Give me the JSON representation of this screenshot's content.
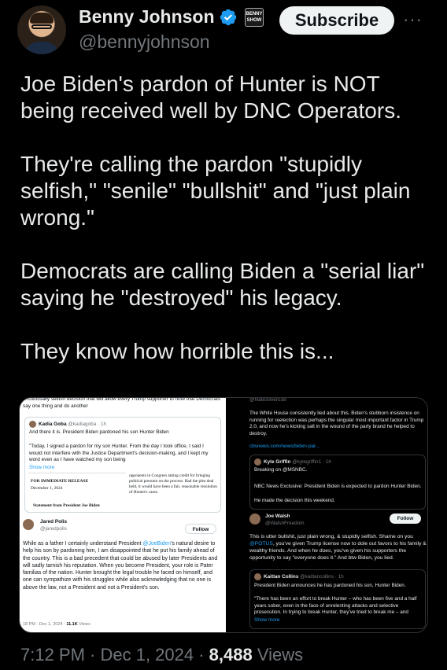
{
  "author": {
    "name": "Benny Johnson",
    "handle": "@bennyjohnson",
    "badge_text": "BENNY SHOW"
  },
  "actions": {
    "subscribe_label": "Subscribe",
    "more_label": "···"
  },
  "tweet": {
    "paragraphs": [
      "Joe Biden's pardon of Hunter is NOT being received well by DNC Operators.",
      "They're calling the pardon \"stupidly selfish,\" \"senile\" \"bullshit\" and \"just plain wrong.\"",
      "Democrats are calling Biden a \"serial liar\" saying he \"destroyed\" his legacy.",
      "They know how horrible this is..."
    ]
  },
  "media": {
    "left": {
      "top_text": "…colossally selfish decision that will allow every Trump supporter to note that Democrats say one thing and do another",
      "quote": {
        "name": "Kadia Goba",
        "meta": "@kadiagoba · 1h",
        "line1": "And there it is.  President Biden pardoned  his son Hunter Biden",
        "body": "\"Today, I signed a pardon for my son Hunter. From the day I took office, I said I would not interfere with the Justice Department's decision-making, and I kept my word even as I have watched my son being",
        "show_more": "Show more",
        "doc_header": "FOR IMMEDIATE RELEASE",
        "doc_date": "December 1, 2024",
        "doc_title": "Statement from President Joe Biden",
        "doc_side": "opponents in Congress taking credit for bringing political pressure on the process. Had the plea deal held, it would have been a fair, reasonable resolution of Hunter's cases."
      },
      "post": {
        "name": "Jared Polis",
        "handle": "@jaredpolis",
        "follow": "Follow",
        "body_pre": "While as a father I certainly understand President ",
        "mention": "@JoeBiden",
        "body_post": "'s natural desire to help his son by pardoning him, I am disappointed that he put his family ahead of the country. This is a bad precedent that could be abused by later Presidents and will sadly tarnish his reputation. When you become President, your role is Pater familias of the nation. Hunter brought the legal trouble he faced on himself, and one can sympathize with his struggles while also acknowledging that no one is above the law, not a President and not a President's son.",
        "time": "18 PM · Dec 1, 2024 · ",
        "views": "11.1K",
        "views_label": " Views"
      }
    },
    "right": {
      "top_handle": "@NateSilver538",
      "top_body": "The White House consistently lied about this. Biden's stubborn insistence on running for reelection was perhaps the singular most important factor in Trump 2.0, and now he's kicking salt in the wound of the party brand he helped to destroy.",
      "top_link": "cbsnews.com/news/biden-par...",
      "quote1": {
        "name": "Kyle Griffin",
        "meta": "@kylegriffin1 · 1h",
        "line1": "Breaking on @MSNBC.",
        "line2": "NBC News Exclusive: President Biden is expected to pardon Hunter Biden.",
        "line3": "He made the decision this weekend."
      },
      "post": {
        "name": "Joe Walsh",
        "handle": "@WalshFreedom",
        "follow": "Follow",
        "body_pre": "This is utter bullshit, just plain wrong, & stupidly selfish. Shame on you ",
        "mention": "@POTUS",
        "body_post": ", you've given Trump license now to dole out favors to his family & wealthy friends. And when he does, you've given his supporters the opportunity to say \"everyone does it.\" And btw Biden, you lied."
      },
      "quote2": {
        "name": "Kaitlan Collins",
        "meta": "@kaitlancollins · 1h",
        "line1": "President Biden announces he has pardoned his son, Hunter Biden.",
        "body": "\"There has been an effort to break Hunter – who has been five and a half years sober, even in the face of unrelenting attacks and selective prosecution. In trying to break Hunter, they've tried to break me – and",
        "show_more": "Show more"
      }
    }
  },
  "footer": {
    "time": "7:12 PM · Dec 1, 2024 · ",
    "views": "8,488",
    "views_label": " Views"
  },
  "colors": {
    "accent": "#1d9bf0",
    "background": "#000000",
    "text": "#e7e9ea",
    "muted": "#71767b"
  },
  "icons": [
    "verified-badge-icon",
    "more-icon"
  ]
}
